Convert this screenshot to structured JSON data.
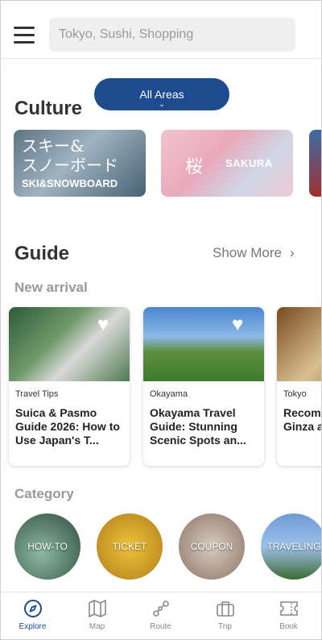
{
  "search": {
    "placeholder": "Tokyo, Sushi, Shopping"
  },
  "area_selector": {
    "label": "All Areas",
    "chevron": "⌄"
  },
  "culture": {
    "title": "Culture",
    "cards": [
      {
        "jp": "スキー&\nスノーボード",
        "en": "SKI&SNOWBOARD"
      },
      {
        "jp": "桜",
        "en": "SAKURA"
      }
    ]
  },
  "guide": {
    "title": "Guide",
    "show_more": "Show More",
    "new_arrival": "New arrival",
    "cards": [
      {
        "tag": "Travel Tips",
        "title": "Suica & Pasmo Guide 2026: How to Use Japan's T..."
      },
      {
        "tag": "Okayama",
        "title": "Okayama Travel Guide: Stunning Scenic Spots an..."
      },
      {
        "tag": "Tokyo",
        "title": "Recom Ramen Ginza a"
      }
    ]
  },
  "category": {
    "title": "Category",
    "items": [
      "HOW-TO",
      "TICKET",
      "COUPON",
      "TRAVELING"
    ]
  },
  "nav": {
    "items": [
      {
        "label": "Explore",
        "icon": "compass-icon"
      },
      {
        "label": "Map",
        "icon": "map-icon"
      },
      {
        "label": "Route",
        "icon": "route-icon"
      },
      {
        "label": "Trip",
        "icon": "suitcase-icon"
      },
      {
        "label": "Book",
        "icon": "ticket-icon"
      }
    ]
  },
  "colors": {
    "accent": "#1e4a8e"
  }
}
